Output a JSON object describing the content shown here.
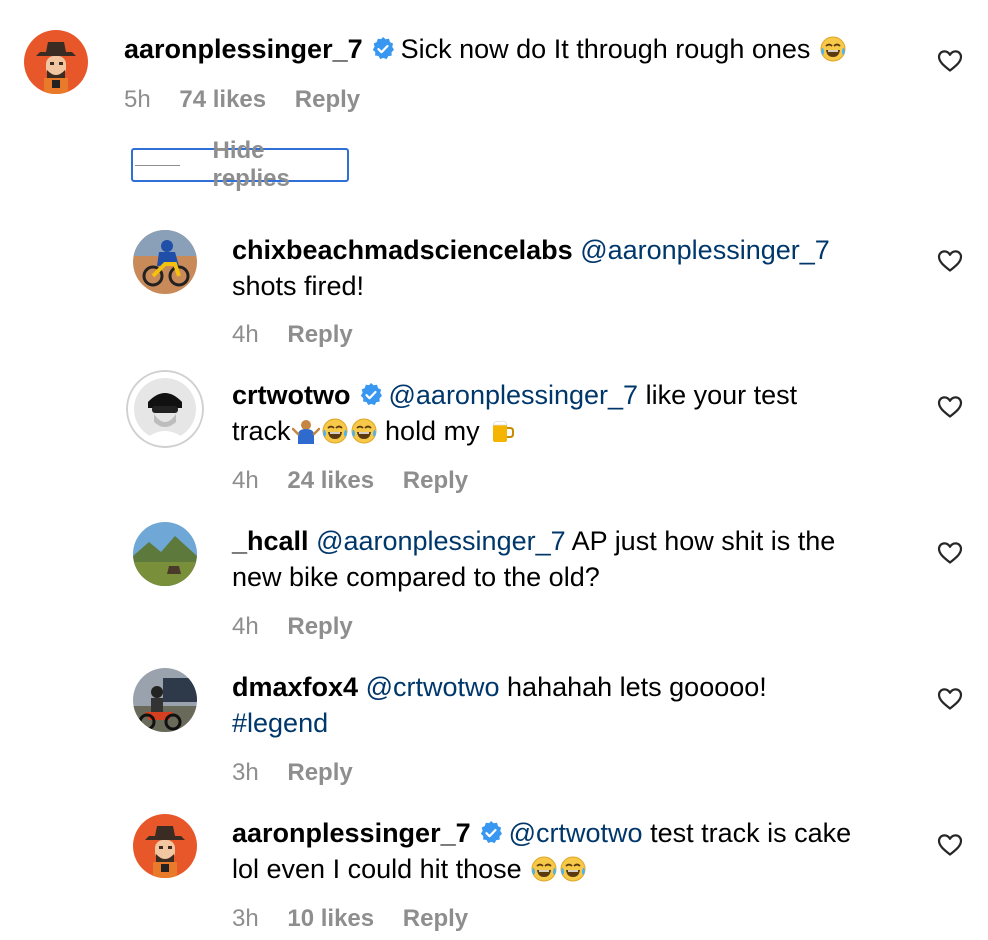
{
  "colors": {
    "accent": "#0095f6",
    "mention": "#00376b",
    "meta": "#8e8e8e",
    "verified": "#3897f0"
  },
  "comments": [
    {
      "username": "aaronplessinger_7",
      "verified": true,
      "mention": "",
      "text": "Sick now do It through rough ones",
      "text_line2": "",
      "time": "5h",
      "likes": "74 likes",
      "reply": "Reply",
      "emoji": [
        "face-with-tears-of-joy"
      ]
    },
    {
      "username": "chixbeachmadsciencelabs",
      "verified": false,
      "mention": "@aaronplessinger_7",
      "text": "",
      "text_line2": "shots fired!",
      "time": "4h",
      "likes": "",
      "reply": "Reply"
    },
    {
      "username": "crtwotwo",
      "verified": true,
      "mention": "@aaronplessinger_7",
      "text": "like your test",
      "text_line2a": "track",
      "text_line2b": "hold my",
      "time": "4h",
      "likes": "24 likes",
      "reply": "Reply",
      "emoji": [
        "person-shrugging",
        "face-with-tears-of-joy",
        "face-with-tears-of-joy",
        "beer-mug"
      ]
    },
    {
      "username": "_hcall",
      "verified": false,
      "mention": "@aaronplessinger_7",
      "text": "AP just how shit is the",
      "text_line2": "new bike compared to the old?",
      "time": "4h",
      "likes": "",
      "reply": "Reply"
    },
    {
      "username": "dmaxfox4",
      "verified": false,
      "mention": "@crtwotwo",
      "text": "hahahah lets gooooo!",
      "hashtag": "#legend",
      "time": "3h",
      "likes": "",
      "reply": "Reply"
    },
    {
      "username": "aaronplessinger_7",
      "verified": true,
      "mention": "@crtwotwo",
      "text": "test track is cake",
      "text_line2": "lol even I could hit those",
      "time": "3h",
      "likes": "10 likes",
      "reply": "Reply",
      "emoji": [
        "face-with-tears-of-joy",
        "face-with-tears-of-joy"
      ]
    }
  ],
  "hide_replies": "Hide replies"
}
